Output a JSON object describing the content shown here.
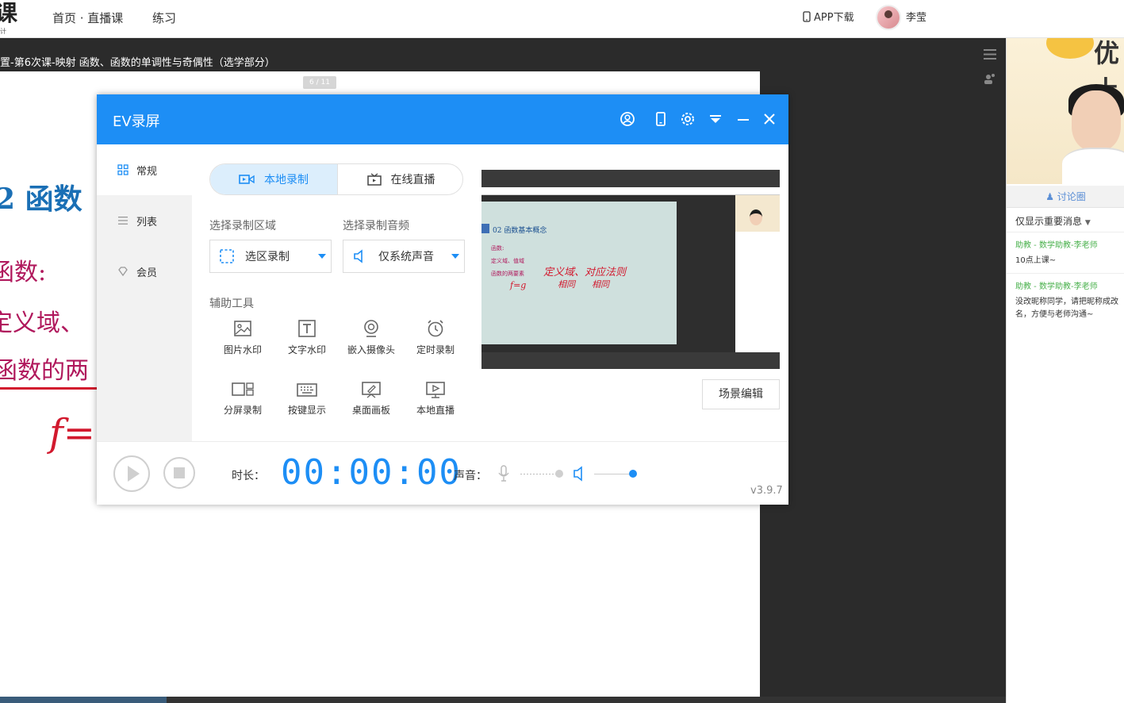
{
  "nav": {
    "logo_char": "课",
    "logo_sub": "计 本",
    "items": [
      "首页 · 直播课",
      "练习"
    ],
    "app_download": "APP下载",
    "user_name": "李莹"
  },
  "course": {
    "title": "置-第6次课-映射 函数、函数的单调性与奇偶性（选学部分）",
    "page_indicator": "6 / 11"
  },
  "slide": {
    "title": "2  函数",
    "line1": "函数:",
    "line2": "定义域、",
    "line3": "函数的两",
    "handwriting": "f="
  },
  "live_panel": {
    "brand": "优上",
    "discuss_tab": "讨论圈",
    "filter": "仅显示重要消息",
    "messages": [
      {
        "who": "助教 - 数学助教-李老师",
        "text": "10点上课~"
      },
      {
        "who": "助教 - 数学助教-李老师",
        "text": "没改昵称同学，请把昵称成改名，方便与老师沟通~"
      }
    ]
  },
  "ev": {
    "title": "EV录屏",
    "sidebar": [
      "常规",
      "列表",
      "会员"
    ],
    "modes": [
      "本地录制",
      "在线直播"
    ],
    "area_label": "选择录制区域",
    "audio_label": "选择录制音频",
    "area_value": "选区录制",
    "audio_value": "仅系统声音",
    "tools_label": "辅助工具",
    "tools_row1": [
      "图片水印",
      "文字水印",
      "嵌入摄像头",
      "定时录制"
    ],
    "tools_row2": [
      "分屏录制",
      "按键显示",
      "桌面画板",
      "本地直播"
    ],
    "scene_edit": "场景编辑",
    "duration_label": "时长：",
    "timer": "00:00:00",
    "sound_label": "声音：",
    "version": "v3.9.7",
    "preview": {
      "slide_title": "02  函数基本概念",
      "b1": "函数:",
      "b2": "定义域、值域",
      "b3": "函数的两要素",
      "hand1": "定义域、对应法则",
      "hand2": "相同      相同",
      "hand3": "f=g"
    }
  },
  "colors": {
    "accent": "#1d8ef5",
    "slide_title": "#1a6fb5",
    "slide_text": "#b0185c",
    "handwriting": "#d2192e",
    "assistant": "#48b04b"
  }
}
